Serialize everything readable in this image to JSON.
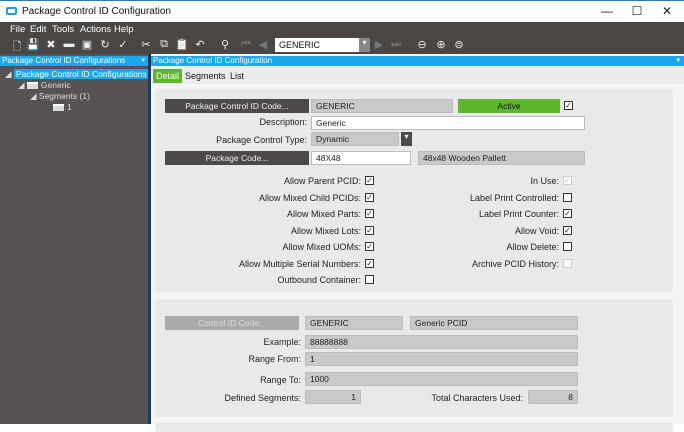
{
  "window": {
    "title": "Package Control ID Configuration",
    "minimize": "—",
    "maximize": "☐",
    "close": "✕"
  },
  "menu": [
    "File",
    "Edit",
    "Tools",
    "Actions",
    "Help"
  ],
  "toolbar": {
    "nav_value": "GENERIC"
  },
  "left_panel": {
    "title": "Package Control ID Configurations",
    "pin": "📌",
    "tree": {
      "root": "Package Control ID Configurations",
      "child": "Generic",
      "segments": "Segments (1)",
      "segment": "1"
    }
  },
  "right_panel": {
    "title": "Package Control ID Configuration",
    "tabs": [
      "Detail",
      "Segments",
      "List"
    ]
  },
  "detail": {
    "code_button": "Package Control ID Code...",
    "code_value": "GENERIC",
    "status": "Active",
    "status_checked": true,
    "description_label": "Description:",
    "description_value": "Generic",
    "type_label": "Package Control Type:",
    "type_value": "Dynamic",
    "package_code_button": "Package Code...",
    "package_code_value": "48X48",
    "package_code_desc": "48x48 Wooden Pallett",
    "left_checks": [
      {
        "label": "Allow Parent PCID:",
        "checked": true
      },
      {
        "label": "Allow Mixed Child PCIDs:",
        "checked": true
      },
      {
        "label": "Allow Mixed Parts:",
        "checked": true
      },
      {
        "label": "Allow Mixed Lots:",
        "checked": true
      },
      {
        "label": "Allow Mixed UOMs:",
        "checked": true
      },
      {
        "label": "Allow Multiple Serial Numbers:",
        "checked": true
      },
      {
        "label": "Outbound Container:",
        "checked": false
      }
    ],
    "right_checks": [
      {
        "label": "In Use:",
        "checked": true,
        "disabled": true
      },
      {
        "label": "Label Print Controlled:",
        "checked": false
      },
      {
        "label": "Label Print Counter:",
        "checked": true
      },
      {
        "label": "Allow Void:",
        "checked": true
      },
      {
        "label": "Allow Delete:",
        "checked": false
      },
      {
        "label": "Archive PCID History:",
        "checked": false,
        "disabled": true
      }
    ]
  },
  "control": {
    "button": "Control ID Code...",
    "code": "GENERIC",
    "desc": "Generic PCID",
    "example_label": "Example:",
    "example": "88888888",
    "range_from_label": "Range From:",
    "range_from": "1",
    "range_to_label": "Range To:",
    "range_to": "1000",
    "defined_label": "Defined Segments:",
    "defined": "1",
    "total_label": "Total Characters Used:",
    "total": "8"
  },
  "colors": {
    "accent": "#1aa7ec",
    "active": "#5cb82a",
    "dark": "#4a4644"
  }
}
